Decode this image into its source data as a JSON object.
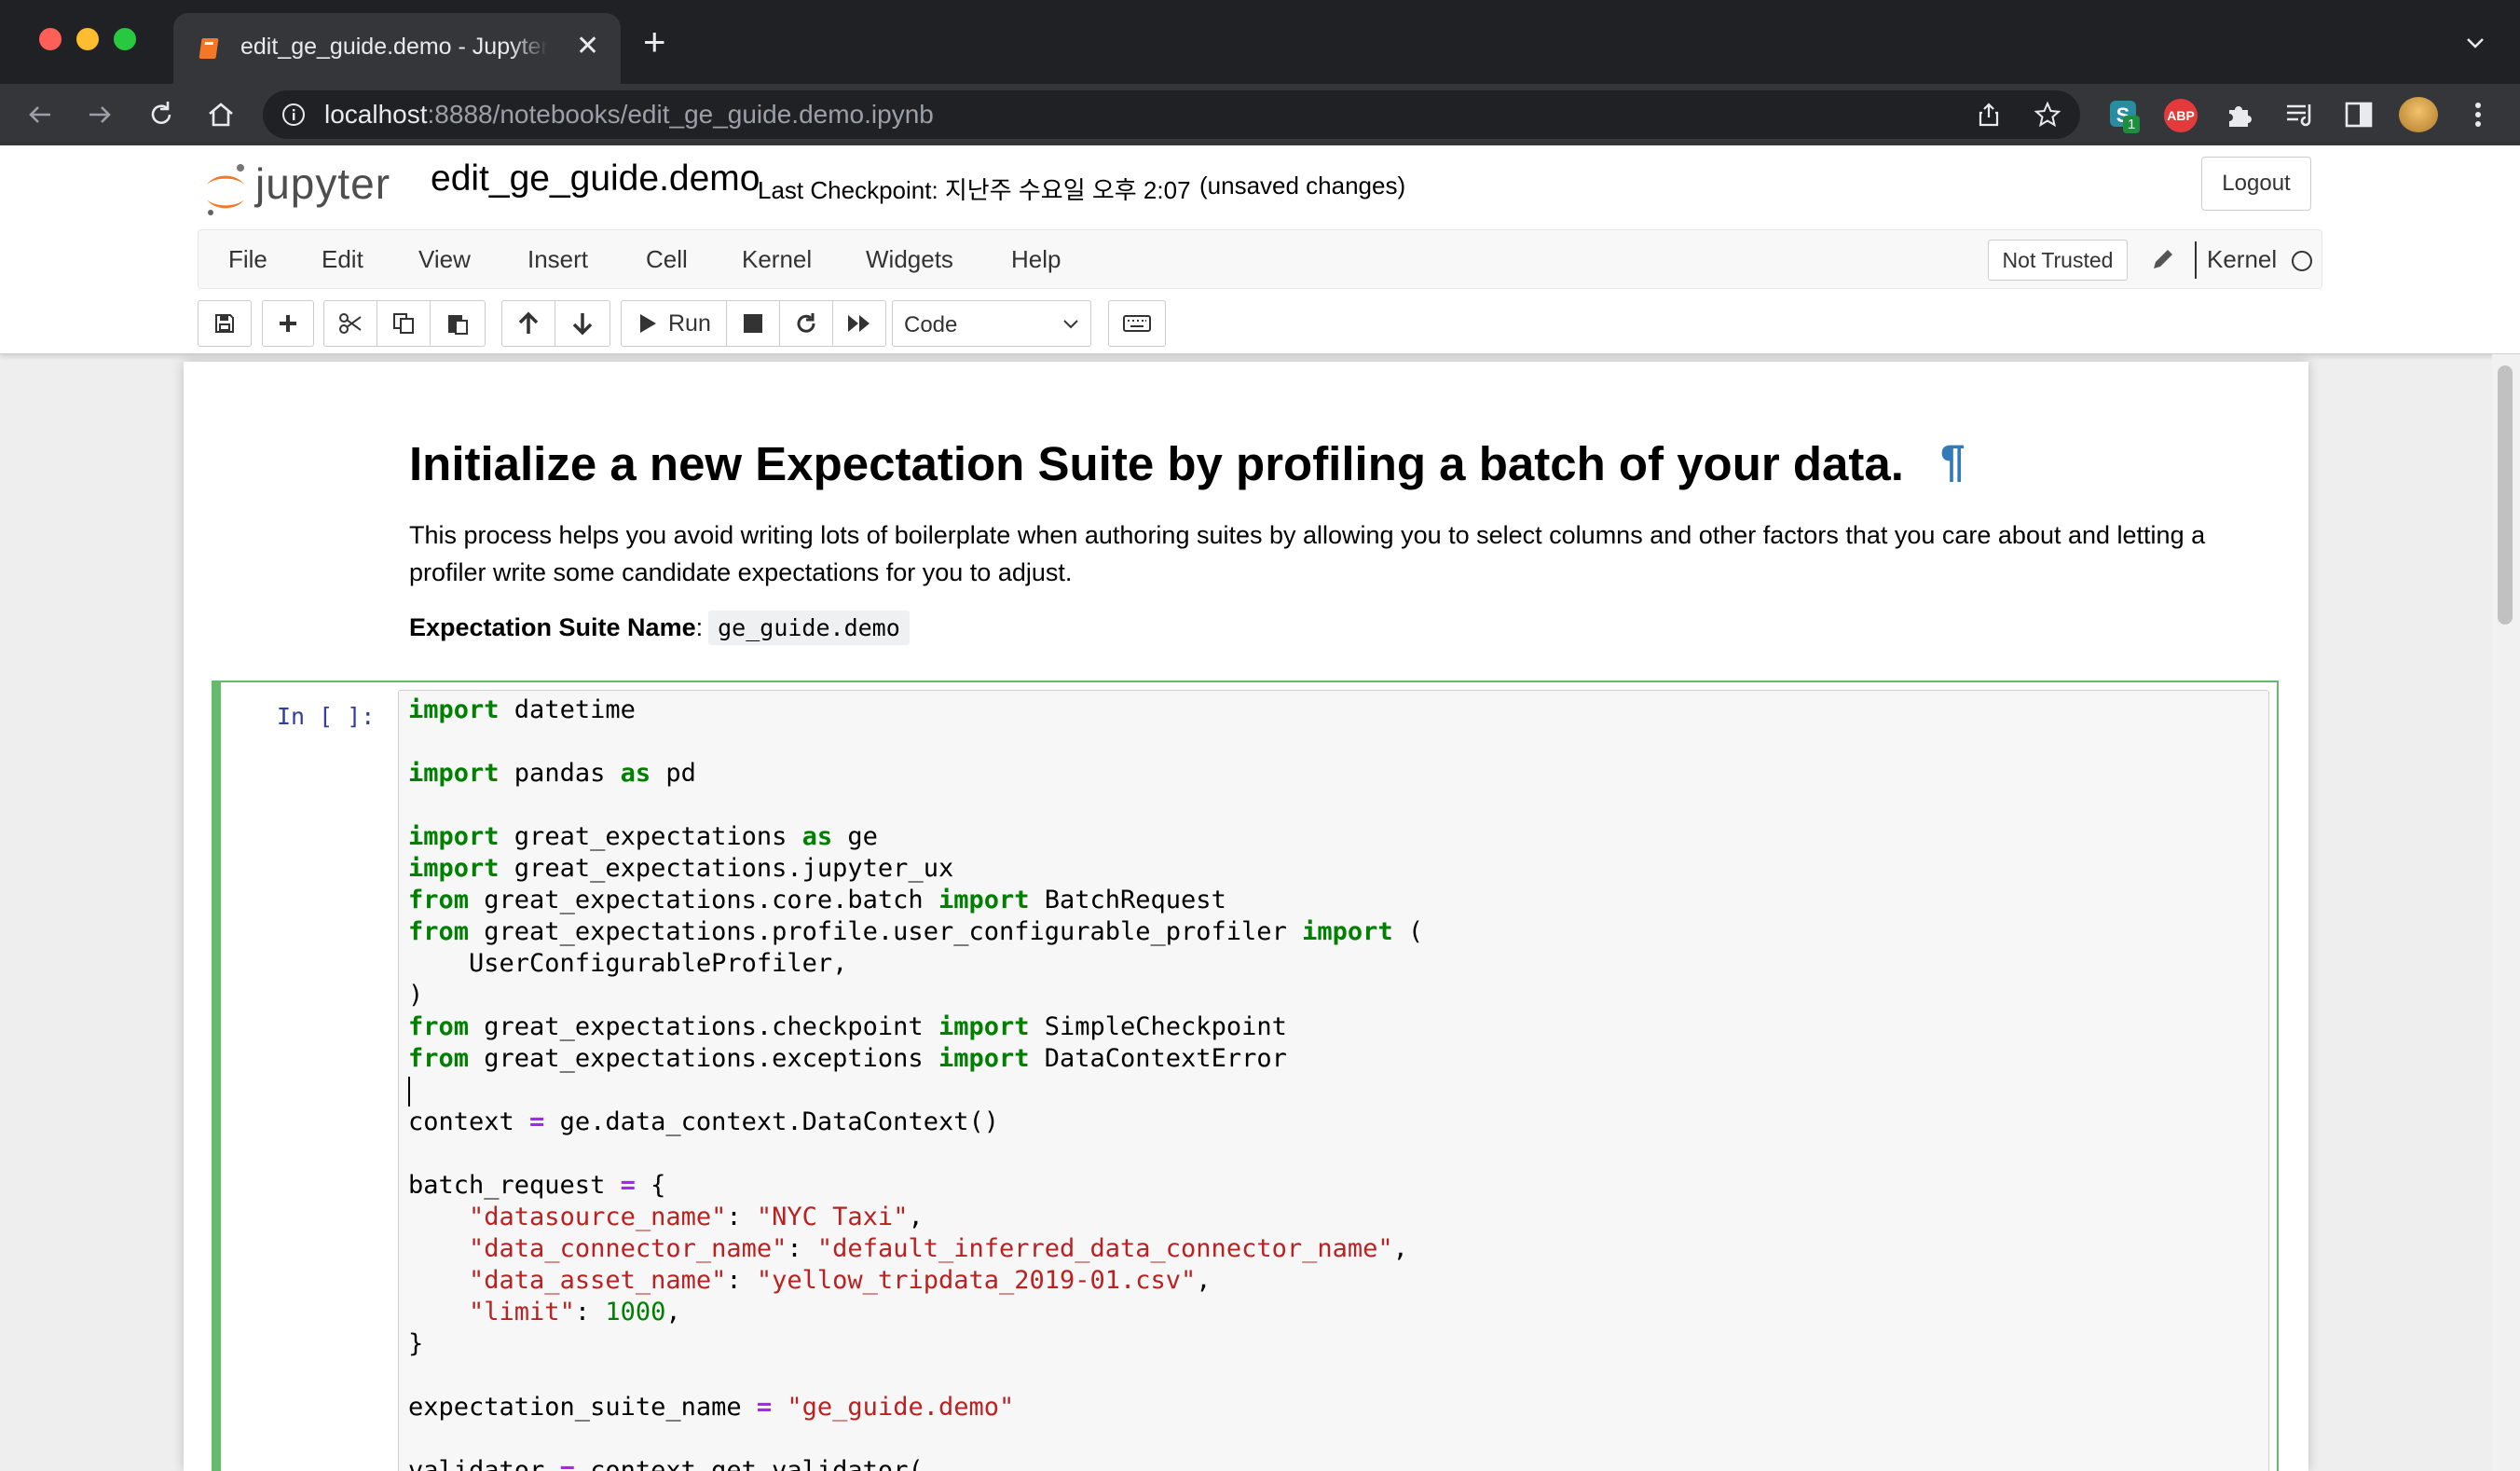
{
  "browser": {
    "tab_title": "edit_ge_guide.demo - Jupyter Notebook",
    "url_host": "localhost",
    "url_path": ":8888/notebooks/edit_ge_guide.demo.ipynb",
    "extension_badge": "1",
    "abp_label": "ABP"
  },
  "header": {
    "logo_text": "jupyter",
    "notebook_name": "edit_ge_guide.demo",
    "checkpoint": "Last Checkpoint: 지난주 수요일 오후 2:07",
    "autosave_status": "(unsaved changes)",
    "logout_label": "Logout"
  },
  "menu": {
    "items": [
      "File",
      "Edit",
      "View",
      "Insert",
      "Cell",
      "Kernel",
      "Widgets",
      "Help"
    ],
    "trust_label": "Not Trusted",
    "kernel_label": "Kernel"
  },
  "toolbar": {
    "run_label": "Run",
    "cell_type": "Code"
  },
  "markdown": {
    "heading": "Initialize a new Expectation Suite by profiling a batch of your data.",
    "pilcrow": "¶",
    "paragraph": "This process helps you avoid writing lots of boilerplate when authoring suites by allowing you to select columns and other factors that you care about and letting a profiler write some candidate expectations for you to adjust.",
    "suite_name_label": "Expectation Suite Name",
    "suite_name_sep": ":",
    "suite_name_value": "ge_guide.demo"
  },
  "cell": {
    "prompt": "In [ ]:"
  }
}
